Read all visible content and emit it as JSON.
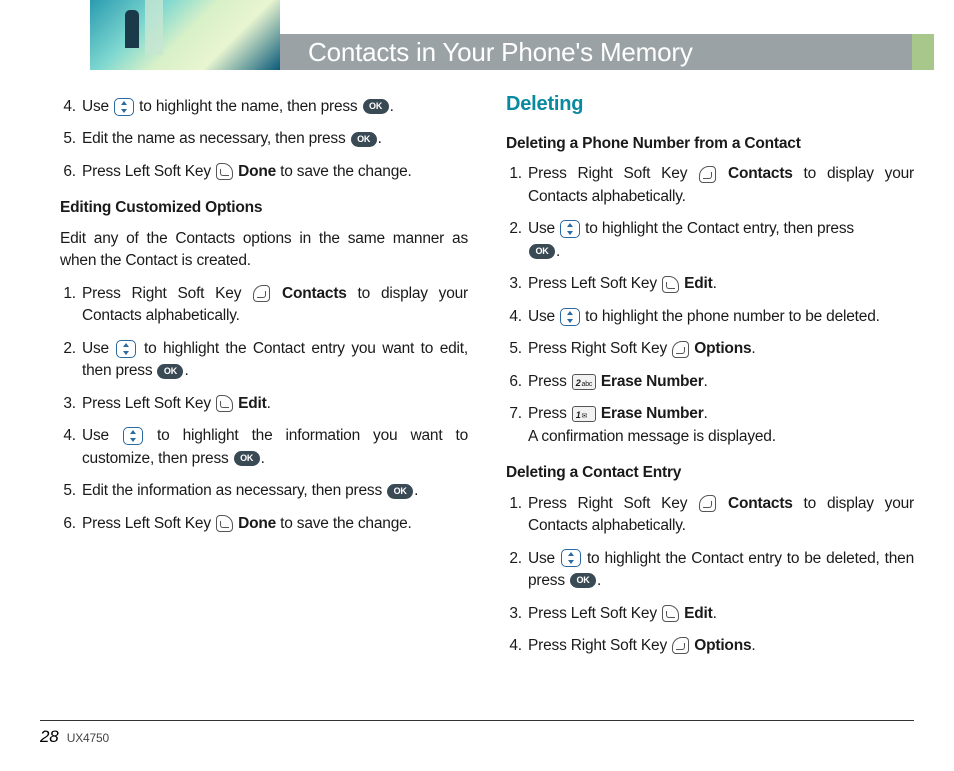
{
  "header": {
    "title": "Contacts in Your Phone's Memory"
  },
  "left": {
    "cont_steps": [
      {
        "pre": "Use ",
        "icon": "nav",
        "mid": " to highlight the name, then press ",
        "icon2": "ok",
        "post": "."
      },
      {
        "pre": "Edit the name as necessary, then press ",
        "icon": "ok",
        "post": "."
      },
      {
        "pre": "Press Left Soft Key ",
        "icon": "soft",
        "bold": "Done",
        "post": " to save the change."
      }
    ],
    "sub1": "Editing Customized Options",
    "para1": "Edit any of the Contacts options in the same manner as when the Contact is created.",
    "steps2": [
      {
        "pre": "Press Right Soft Key ",
        "icon": "soft-r",
        "bold": "Contacts",
        "post": " to display your Contacts alphabetically."
      },
      {
        "pre": "Use ",
        "icon": "nav",
        "mid": " to highlight the Contact entry you want to edit, then press ",
        "icon2": "ok",
        "post": "."
      },
      {
        "pre": "Press Left Soft Key ",
        "icon": "soft",
        "bold": "Edit",
        "post": "."
      },
      {
        "pre": "Use ",
        "icon": "nav",
        "mid": " to highlight the information you want to customize, then press ",
        "icon2": "ok",
        "post": "."
      },
      {
        "pre": "Edit the information as necessary, then press ",
        "icon": "ok",
        "post": "."
      },
      {
        "pre": "Press Left Soft Key ",
        "icon": "soft",
        "bold": "Done",
        "post": " to save the change."
      }
    ]
  },
  "right": {
    "heading": "Deleting",
    "sub1": "Deleting a Phone Number from a Contact",
    "steps1": [
      {
        "pre": "Press Right Soft Key ",
        "icon": "soft-r",
        "bold": "Contacts",
        "post": " to display your Contacts alphabetically."
      },
      {
        "pre": "Use ",
        "icon": "nav",
        "mid": " to highlight the Contact entry, then press ",
        "icon2_newline": true,
        "icon2": "ok",
        "post": "."
      },
      {
        "pre": "Press Left Soft Key ",
        "icon": "soft",
        "bold": "Edit",
        "post": "."
      },
      {
        "pre": "Use ",
        "icon": "nav",
        "mid": " to highlight the phone number to be deleted.",
        "post": ""
      },
      {
        "pre": "Press Right Soft Key ",
        "icon": "soft-r",
        "bold": "Options",
        "post": "."
      },
      {
        "pre": "Press ",
        "icon": "num2",
        "bold": "Erase Number",
        "post": "."
      },
      {
        "pre": "Press ",
        "icon": "num1",
        "bold": "Erase Number",
        "post": ".",
        "extra": "A confirmation message is displayed."
      }
    ],
    "sub2": "Deleting a Contact Entry",
    "steps2": [
      {
        "pre": "Press Right Soft Key ",
        "icon": "soft-r",
        "bold": "Contacts",
        "post": " to display your Contacts alphabetically."
      },
      {
        "pre": "Use ",
        "icon": "nav",
        "mid": " to highlight the Contact entry to be deleted, then press ",
        "icon2": "ok",
        "post": "."
      },
      {
        "pre": "Press Left Soft Key ",
        "icon": "soft",
        "bold": "Edit",
        "post": "."
      },
      {
        "pre": "Press Right Soft Key ",
        "icon": "soft-r",
        "bold": "Options",
        "post": "."
      }
    ]
  },
  "footer": {
    "page": "28",
    "model": "UX4750"
  }
}
